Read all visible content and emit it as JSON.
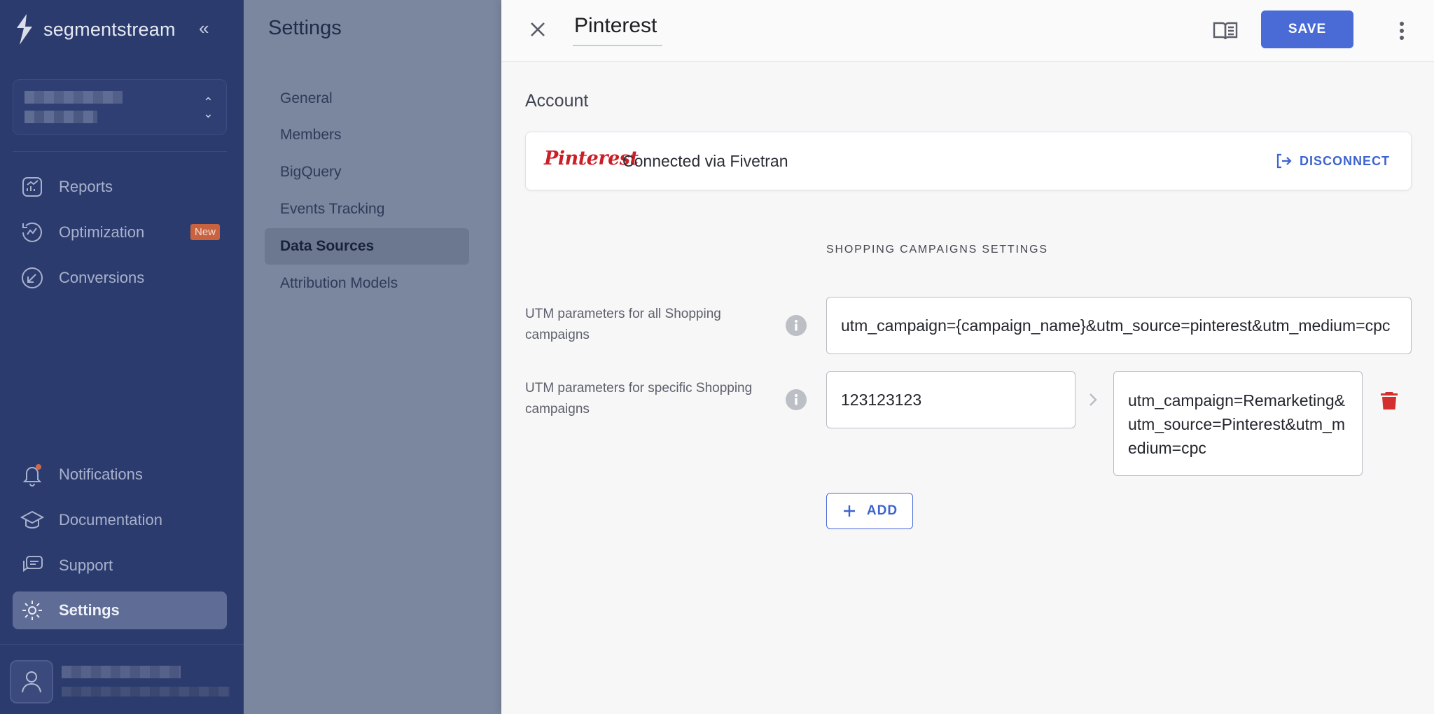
{
  "brand": {
    "name": "segmentstream"
  },
  "nav": {
    "items": [
      {
        "label": "Reports"
      },
      {
        "label": "Optimization",
        "badge": "New"
      },
      {
        "label": "Conversions"
      }
    ],
    "bottom": [
      {
        "label": "Notifications"
      },
      {
        "label": "Documentation"
      },
      {
        "label": "Support"
      },
      {
        "label": "Settings"
      }
    ]
  },
  "settings": {
    "title": "Settings",
    "items": [
      "General",
      "Members",
      "BigQuery",
      "Events Tracking",
      "Data Sources",
      "Attribution Models"
    ],
    "active": "Data Sources"
  },
  "drawer": {
    "title": "Pinterest",
    "save_label": "SAVE",
    "account": {
      "heading": "Account",
      "logo_text": "Pinterest",
      "status": "Connected via Fivetran",
      "disconnect_label": "DISCONNECT"
    },
    "section_title": "SHOPPING CAMPAIGNS SETTINGS",
    "fields": {
      "all_label": "UTM parameters for all Shopping campaigns",
      "all_value": "utm_campaign={campaign_name}&utm_source=pinterest&utm_medium=cpc",
      "specific_label": "UTM parameters for specific Shopping campaigns",
      "specific_id": "123123123",
      "specific_value": "utm_campaign=Remarketing&utm_source=Pinterest&utm_medium=cpc"
    },
    "add_label": "ADD"
  },
  "colors": {
    "sidebar": "#2b3b6e",
    "accent": "#4a6bd6",
    "pinterest": "#cb1f27",
    "delete": "#d32f2f",
    "badge": "#c9623f"
  }
}
